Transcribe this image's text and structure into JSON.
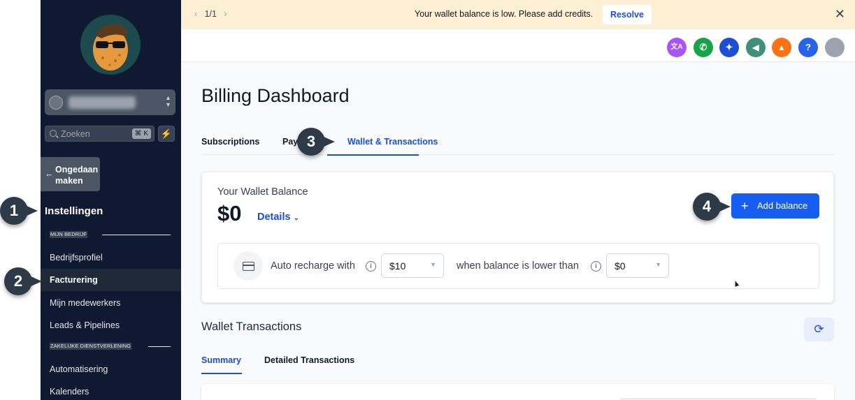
{
  "banner": {
    "pager": "1/1",
    "message": "Your wallet balance is low. Please add credits.",
    "resolve_label": "Resolve",
    "close_icon": "close-icon"
  },
  "sidebar": {
    "search_placeholder": "Zoeken",
    "search_shortcut": "⌘ K",
    "undo_label": "Ongedaan maken",
    "settings_title": "Instellingen",
    "sections": [
      {
        "label": "MIJN BEDRIJF"
      },
      {
        "label": "ZAKELIJKE DIENSTVERLENING"
      }
    ],
    "items": [
      {
        "label": "Bedrijfsprofiel"
      },
      {
        "label": "Facturering",
        "active": true
      },
      {
        "label": "Mijn medewerkers"
      },
      {
        "label": "Leads & Pipelines"
      },
      {
        "label": "Automatisering"
      },
      {
        "label": "Kalenders"
      }
    ]
  },
  "header": {
    "icons": [
      {
        "name": "translate-icon",
        "color": "#a855f7",
        "glyph": "文A"
      },
      {
        "name": "phone-icon",
        "color": "#16a34a",
        "glyph": "✆"
      },
      {
        "name": "sparkles-icon",
        "color": "#1d4ed8",
        "glyph": "✦"
      },
      {
        "name": "megaphone-icon",
        "color": "#3f8f7a",
        "glyph": "📢"
      },
      {
        "name": "bell-icon",
        "color": "#f97316",
        "glyph": "🔔"
      },
      {
        "name": "help-icon",
        "color": "#2563eb",
        "glyph": "?"
      },
      {
        "name": "avatar",
        "color": "#9ca3af",
        "glyph": ""
      }
    ]
  },
  "main": {
    "title": "Billing Dashboard",
    "tabs": [
      {
        "label": "Subscriptions"
      },
      {
        "label": "Pay"
      },
      {
        "label": "Wallet & Transactions",
        "active": true
      }
    ],
    "wallet": {
      "title": "Your Wallet Balance",
      "amount": "$0",
      "details_label": "Details",
      "add_balance_label": "Add balance",
      "recharge_label": "Auto recharge with",
      "recharge_value": "$10",
      "threshold_label": "when balance is lower than",
      "threshold_value": "$0"
    },
    "transactions": {
      "title": "Wallet Transactions",
      "tabs": [
        {
          "label": "Summary",
          "active": true
        },
        {
          "label": "Detailed Transactions"
        }
      ]
    }
  },
  "callouts": [
    "1",
    "2",
    "3",
    "4"
  ],
  "colors": {
    "sidebar_bg": "#0f1932",
    "accent": "#155eef",
    "banner_bg": "#fcefd4"
  }
}
